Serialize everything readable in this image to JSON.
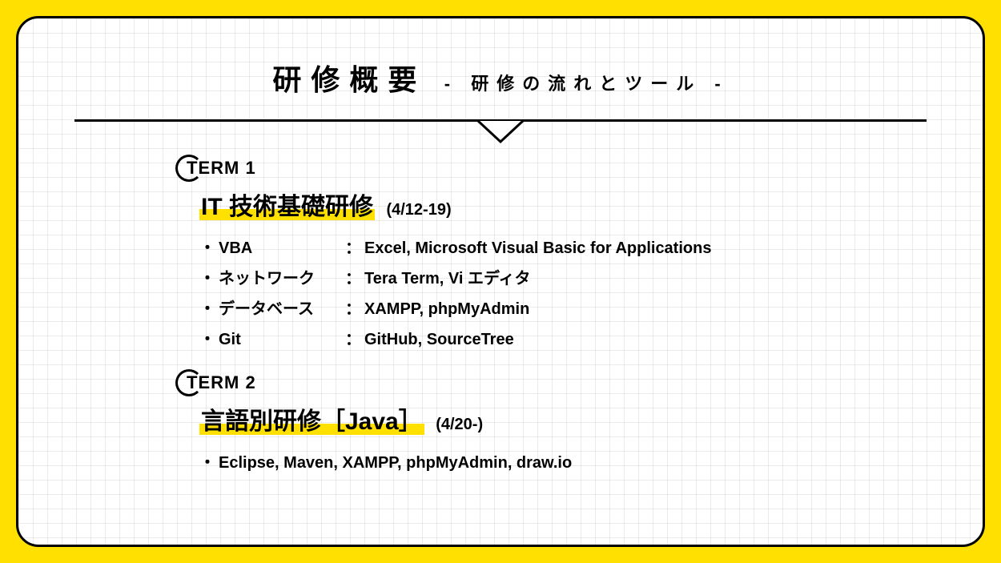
{
  "title": {
    "main": "研修概要",
    "sub": "- 研修の流れとツール -"
  },
  "terms": [
    {
      "label": "TERM 1",
      "section_title": "IT 技術基礎研修",
      "section_date": "(4/12-19)",
      "items": [
        {
          "label": "VBA",
          "value": "Excel, Microsoft Visual Basic for Applications"
        },
        {
          "label": "ネットワーク",
          "value": "Tera Term, Vi エディタ"
        },
        {
          "label": "データベース",
          "value": "XAMPP, phpMyAdmin"
        },
        {
          "label": "Git",
          "value": "GitHub, SourceTree"
        }
      ]
    },
    {
      "label": "TERM 2",
      "section_title": "言語別研修［Java］",
      "section_date": "(4/20-)",
      "items_flat": [
        "Eclipse, Maven, XAMPP, phpMyAdmin, draw.io"
      ]
    }
  ]
}
